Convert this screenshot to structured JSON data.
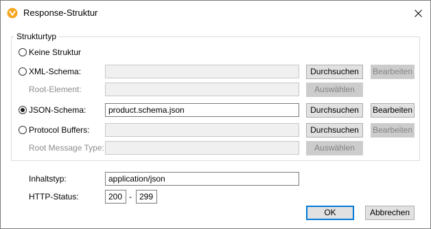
{
  "window": {
    "title": "Response-Struktur"
  },
  "group": {
    "legend": "Strukturtyp"
  },
  "options": {
    "none": {
      "label": "Keine Struktur",
      "selected": false
    },
    "xml": {
      "label": "XML-Schema:",
      "selected": false,
      "value": "",
      "browse": "Durchsuchen",
      "edit": "Bearbeiten",
      "root_label": "Root-Element:",
      "root_value": "",
      "select": "Auswählen"
    },
    "json": {
      "label": "JSON-Schema:",
      "selected": true,
      "value": "product.schema.json",
      "browse": "Durchsuchen",
      "edit": "Bearbeiten"
    },
    "protobuf": {
      "label": "Protocol Buffers:",
      "selected": false,
      "value": "",
      "browse": "Durchsuchen",
      "edit": "Bearbeiten",
      "root_label": "Root Message Type:",
      "root_value": "",
      "select": "Auswählen"
    }
  },
  "content_type": {
    "label": "Inhaltstyp:",
    "value": "application/json"
  },
  "http_status": {
    "label": "HTTP-Status:",
    "from": "200",
    "separator": "-",
    "to": "299"
  },
  "footer": {
    "ok": "OK",
    "cancel": "Abbrechen"
  },
  "icons": {
    "app": "altova-app-icon",
    "close": "close-icon"
  },
  "colors": {
    "app_icon": "#f5a623",
    "default_button_border": "#0078d7",
    "disabled_text": "#8c8c8c"
  }
}
